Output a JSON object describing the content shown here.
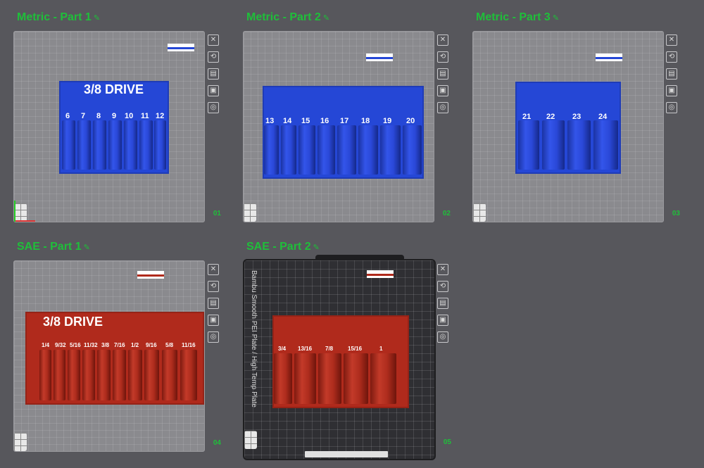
{
  "plates": [
    {
      "id": "metric-part-1",
      "title": "Metric - Part 1",
      "number": "01",
      "color": "#2547d6",
      "tray_title": "3/8 DRIVE",
      "slots": [
        "6",
        "7",
        "8",
        "9",
        "10",
        "11",
        "12"
      ]
    },
    {
      "id": "metric-part-2",
      "title": "Metric - Part 2",
      "number": "02",
      "color": "#2547d6",
      "tray_title": "",
      "slots": [
        "13",
        "14",
        "15",
        "16",
        "17",
        "18",
        "19",
        "20"
      ]
    },
    {
      "id": "metric-part-3",
      "title": "Metric - Part 3",
      "number": "03",
      "color": "#2547d6",
      "tray_title": "",
      "slots": [
        "21",
        "22",
        "23",
        "24"
      ]
    },
    {
      "id": "sae-part-1",
      "title": "SAE - Part 1",
      "number": "04",
      "color": "#b02a1c",
      "tray_title": "3/8 DRIVE",
      "slots": [
        "1/4",
        "9/32",
        "5/16",
        "11/32",
        "3/8",
        "7/16",
        "1/2",
        "9/16",
        "5/8",
        "11/16"
      ]
    },
    {
      "id": "sae-part-2",
      "title": "SAE - Part 2",
      "number": "05",
      "color": "#b02a1c",
      "tray_title": "",
      "slots": [
        "3/4",
        "13/16",
        "7/8",
        "15/16",
        "1"
      ],
      "plate_type": "Bambu Smooth PEI Plate / High Temp Plate"
    }
  ],
  "tools": [
    "close-icon",
    "auto-orient-icon",
    "arrange-icon",
    "lock-icon",
    "settings-icon"
  ],
  "colors": {
    "accent_green": "#1fbf3a",
    "filament_blue": "#2547d6",
    "filament_red": "#b02a1c"
  }
}
